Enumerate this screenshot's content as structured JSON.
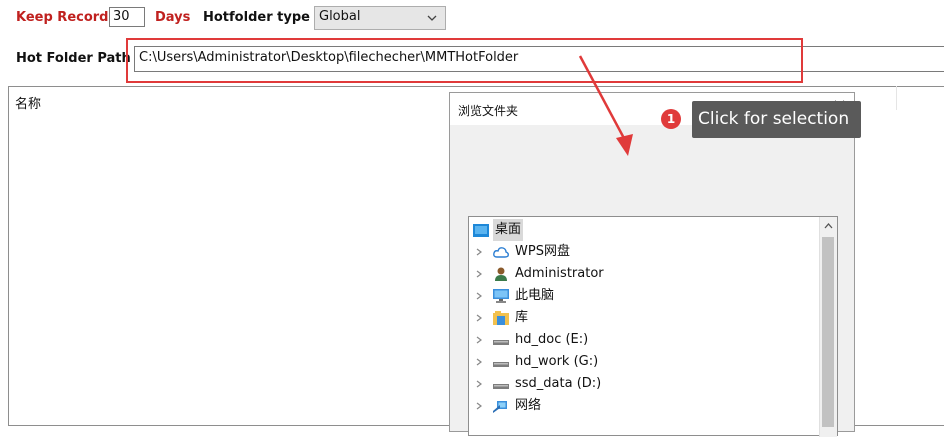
{
  "toolbar": {
    "keep_record_label": "Keep Record",
    "keep_record_value": "30",
    "days_label": "Days",
    "hotfolder_type_label": "Hotfolder type",
    "hotfolder_type_value": "Global"
  },
  "path_row": {
    "label": "Hot Folder Path",
    "value": "C:\\Users\\Administrator\\Desktop\\filechecher\\MMTHotFolder"
  },
  "list": {
    "column_header": "名称"
  },
  "dialog": {
    "title": "浏览文件夹",
    "close": "×",
    "tree": [
      {
        "label": "桌面",
        "icon": "desktop-icon",
        "selected": true,
        "expandable": false
      },
      {
        "label": "WPS网盘",
        "icon": "cloud-icon",
        "expandable": true
      },
      {
        "label": "Administrator",
        "icon": "user-icon",
        "expandable": true
      },
      {
        "label": "此电脑",
        "icon": "computer-icon",
        "expandable": true
      },
      {
        "label": "库",
        "icon": "library-icon",
        "expandable": true
      },
      {
        "label": "hd_doc (E:)",
        "icon": "drive-icon",
        "expandable": true
      },
      {
        "label": "hd_work (G:)",
        "icon": "drive-icon",
        "expandable": true
      },
      {
        "label": "ssd_data (D:)",
        "icon": "drive-icon",
        "expandable": true
      },
      {
        "label": "网络",
        "icon": "network-icon",
        "expandable": true
      }
    ]
  },
  "tooltip": {
    "step_number": "1",
    "text": "Click for selection"
  },
  "colors": {
    "accent_red": "#c0211f",
    "highlight_red": "#e03a3a",
    "tooltip_bg": "#5a5a5a",
    "selected_row": "#cce8ff"
  }
}
